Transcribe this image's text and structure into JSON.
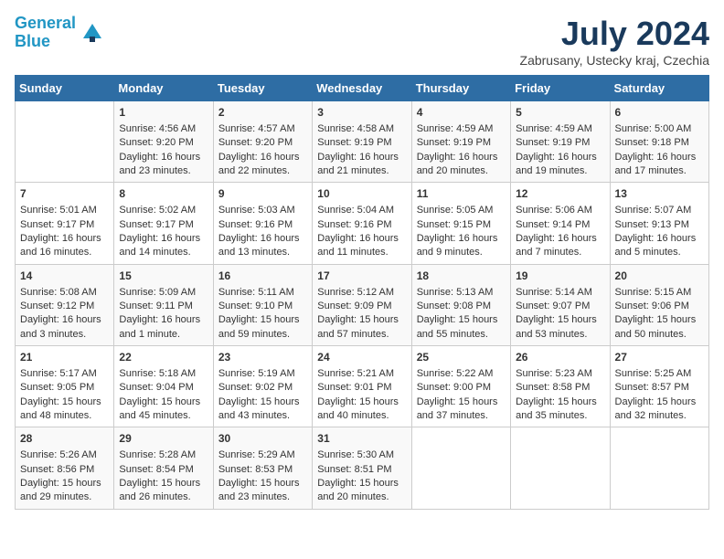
{
  "header": {
    "logo_line1": "General",
    "logo_line2": "Blue",
    "month_title": "July 2024",
    "location": "Zabrusany, Ustecky kraj, Czechia"
  },
  "days_of_week": [
    "Sunday",
    "Monday",
    "Tuesday",
    "Wednesday",
    "Thursday",
    "Friday",
    "Saturday"
  ],
  "weeks": [
    [
      {
        "day": "",
        "content": ""
      },
      {
        "day": "1",
        "content": "Sunrise: 4:56 AM\nSunset: 9:20 PM\nDaylight: 16 hours\nand 23 minutes."
      },
      {
        "day": "2",
        "content": "Sunrise: 4:57 AM\nSunset: 9:20 PM\nDaylight: 16 hours\nand 22 minutes."
      },
      {
        "day": "3",
        "content": "Sunrise: 4:58 AM\nSunset: 9:19 PM\nDaylight: 16 hours\nand 21 minutes."
      },
      {
        "day": "4",
        "content": "Sunrise: 4:59 AM\nSunset: 9:19 PM\nDaylight: 16 hours\nand 20 minutes."
      },
      {
        "day": "5",
        "content": "Sunrise: 4:59 AM\nSunset: 9:19 PM\nDaylight: 16 hours\nand 19 minutes."
      },
      {
        "day": "6",
        "content": "Sunrise: 5:00 AM\nSunset: 9:18 PM\nDaylight: 16 hours\nand 17 minutes."
      }
    ],
    [
      {
        "day": "7",
        "content": "Sunrise: 5:01 AM\nSunset: 9:17 PM\nDaylight: 16 hours\nand 16 minutes."
      },
      {
        "day": "8",
        "content": "Sunrise: 5:02 AM\nSunset: 9:17 PM\nDaylight: 16 hours\nand 14 minutes."
      },
      {
        "day": "9",
        "content": "Sunrise: 5:03 AM\nSunset: 9:16 PM\nDaylight: 16 hours\nand 13 minutes."
      },
      {
        "day": "10",
        "content": "Sunrise: 5:04 AM\nSunset: 9:16 PM\nDaylight: 16 hours\nand 11 minutes."
      },
      {
        "day": "11",
        "content": "Sunrise: 5:05 AM\nSunset: 9:15 PM\nDaylight: 16 hours\nand 9 minutes."
      },
      {
        "day": "12",
        "content": "Sunrise: 5:06 AM\nSunset: 9:14 PM\nDaylight: 16 hours\nand 7 minutes."
      },
      {
        "day": "13",
        "content": "Sunrise: 5:07 AM\nSunset: 9:13 PM\nDaylight: 16 hours\nand 5 minutes."
      }
    ],
    [
      {
        "day": "14",
        "content": "Sunrise: 5:08 AM\nSunset: 9:12 PM\nDaylight: 16 hours\nand 3 minutes."
      },
      {
        "day": "15",
        "content": "Sunrise: 5:09 AM\nSunset: 9:11 PM\nDaylight: 16 hours\nand 1 minute."
      },
      {
        "day": "16",
        "content": "Sunrise: 5:11 AM\nSunset: 9:10 PM\nDaylight: 15 hours\nand 59 minutes."
      },
      {
        "day": "17",
        "content": "Sunrise: 5:12 AM\nSunset: 9:09 PM\nDaylight: 15 hours\nand 57 minutes."
      },
      {
        "day": "18",
        "content": "Sunrise: 5:13 AM\nSunset: 9:08 PM\nDaylight: 15 hours\nand 55 minutes."
      },
      {
        "day": "19",
        "content": "Sunrise: 5:14 AM\nSunset: 9:07 PM\nDaylight: 15 hours\nand 53 minutes."
      },
      {
        "day": "20",
        "content": "Sunrise: 5:15 AM\nSunset: 9:06 PM\nDaylight: 15 hours\nand 50 minutes."
      }
    ],
    [
      {
        "day": "21",
        "content": "Sunrise: 5:17 AM\nSunset: 9:05 PM\nDaylight: 15 hours\nand 48 minutes."
      },
      {
        "day": "22",
        "content": "Sunrise: 5:18 AM\nSunset: 9:04 PM\nDaylight: 15 hours\nand 45 minutes."
      },
      {
        "day": "23",
        "content": "Sunrise: 5:19 AM\nSunset: 9:02 PM\nDaylight: 15 hours\nand 43 minutes."
      },
      {
        "day": "24",
        "content": "Sunrise: 5:21 AM\nSunset: 9:01 PM\nDaylight: 15 hours\nand 40 minutes."
      },
      {
        "day": "25",
        "content": "Sunrise: 5:22 AM\nSunset: 9:00 PM\nDaylight: 15 hours\nand 37 minutes."
      },
      {
        "day": "26",
        "content": "Sunrise: 5:23 AM\nSunset: 8:58 PM\nDaylight: 15 hours\nand 35 minutes."
      },
      {
        "day": "27",
        "content": "Sunrise: 5:25 AM\nSunset: 8:57 PM\nDaylight: 15 hours\nand 32 minutes."
      }
    ],
    [
      {
        "day": "28",
        "content": "Sunrise: 5:26 AM\nSunset: 8:56 PM\nDaylight: 15 hours\nand 29 minutes."
      },
      {
        "day": "29",
        "content": "Sunrise: 5:28 AM\nSunset: 8:54 PM\nDaylight: 15 hours\nand 26 minutes."
      },
      {
        "day": "30",
        "content": "Sunrise: 5:29 AM\nSunset: 8:53 PM\nDaylight: 15 hours\nand 23 minutes."
      },
      {
        "day": "31",
        "content": "Sunrise: 5:30 AM\nSunset: 8:51 PM\nDaylight: 15 hours\nand 20 minutes."
      },
      {
        "day": "",
        "content": ""
      },
      {
        "day": "",
        "content": ""
      },
      {
        "day": "",
        "content": ""
      }
    ]
  ]
}
